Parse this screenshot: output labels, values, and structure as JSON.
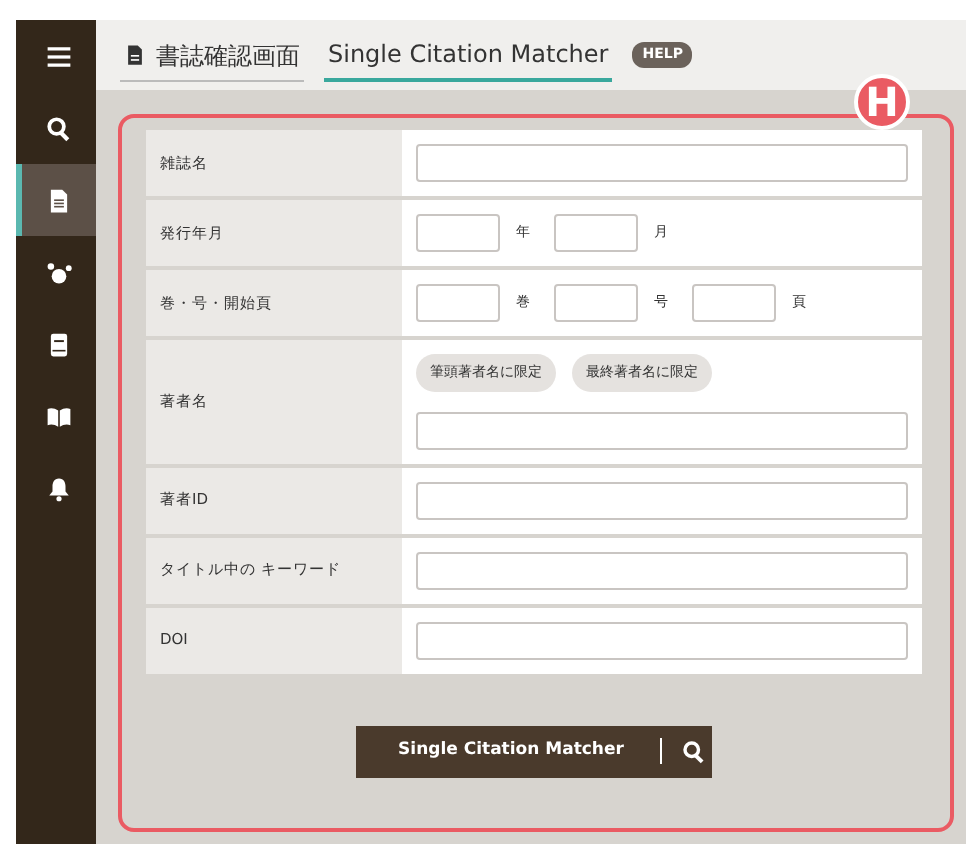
{
  "sidebar": {
    "items": [
      {
        "kind": "menu",
        "selected": false
      },
      {
        "kind": "search",
        "selected": false
      },
      {
        "kind": "document",
        "selected": true
      },
      {
        "kind": "network",
        "selected": false
      },
      {
        "kind": "book",
        "selected": false
      },
      {
        "kind": "open-book",
        "selected": false
      },
      {
        "kind": "bell",
        "selected": false
      }
    ]
  },
  "header": {
    "tabs": [
      {
        "label": "書誌確認画面",
        "selected": false
      },
      {
        "label": "Single Citation Matcher",
        "selected": true
      }
    ],
    "help": "HELP"
  },
  "marker": "H",
  "form": {
    "rows": [
      {
        "label": "雑誌名",
        "kind": "single"
      },
      {
        "label": "発行年月",
        "kind": "units",
        "units": [
          "年",
          "月"
        ]
      },
      {
        "label": "巻・号・開始頁",
        "kind": "units",
        "units": [
          "巻",
          "号",
          "頁"
        ]
      },
      {
        "label": "著者名",
        "kind": "author",
        "buttons": [
          "筆頭著者名に限定",
          "最終著者名に限定"
        ]
      },
      {
        "label": "著者ID",
        "kind": "single"
      },
      {
        "label": "タイトル中の キーワード",
        "kind": "single"
      },
      {
        "label": "DOI",
        "kind": "single"
      }
    ]
  },
  "submit": {
    "label": "Single Citation Matcher"
  }
}
